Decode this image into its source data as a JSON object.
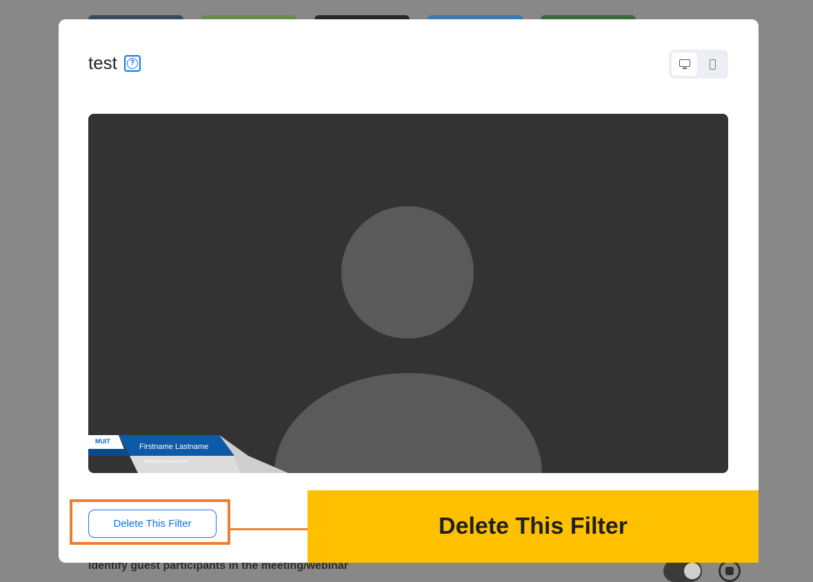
{
  "background": {
    "setting_label": "Identify guest participants in the meeting/webinar",
    "thumb_colors": [
      "#3a4a5a",
      "#6a8a4a",
      "#2a2a2a",
      "#3a7ab0",
      "#3a6a3a"
    ]
  },
  "modal": {
    "title": "test",
    "help_icon": "question-circle-icon",
    "help_glyph": "?",
    "device_options": [
      {
        "icon": "desktop-icon",
        "active": true
      },
      {
        "icon": "mobile-icon",
        "active": false
      }
    ],
    "preview": {
      "lower_third": {
        "org": "MUIT",
        "name": "Firstname Lastname",
        "department": "Multimedia Development"
      }
    },
    "delete_button_label": "Delete This Filter"
  },
  "annotation": {
    "callout_text": "Delete This Filter",
    "highlight_color": "#ed7d31",
    "callout_color": "#ffc000"
  }
}
